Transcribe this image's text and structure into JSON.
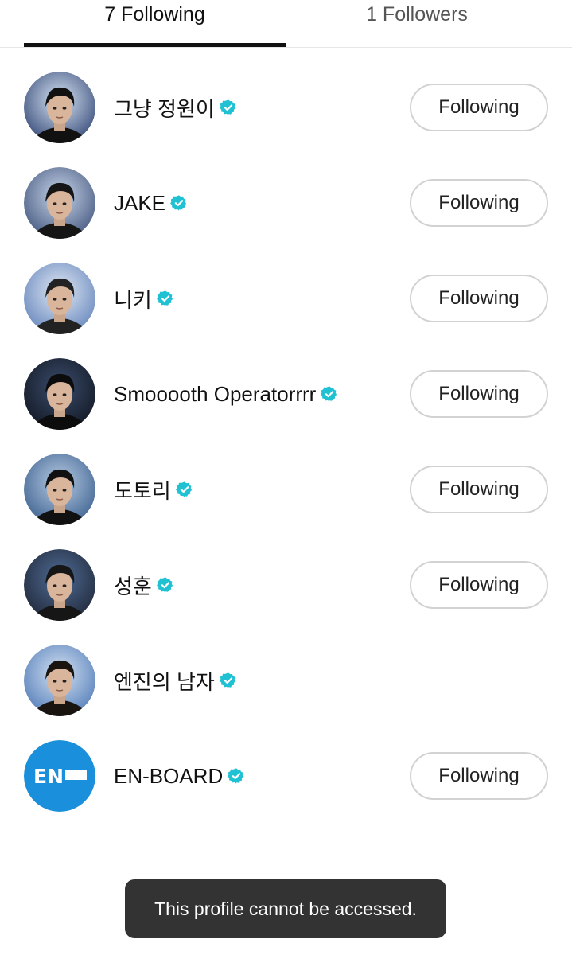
{
  "tabs": {
    "following": "7 Following",
    "followers": "1 Followers",
    "active": "following"
  },
  "accent_color": "#1fc1d3",
  "brand_color": "#1a8fdb",
  "follow_button_label": "Following",
  "users": [
    {
      "name": "그냥 정원이",
      "verified": true,
      "has_button": true,
      "avatar": "portrait"
    },
    {
      "name": "JAKE",
      "verified": true,
      "has_button": true,
      "avatar": "portrait"
    },
    {
      "name": "니키",
      "verified": true,
      "has_button": true,
      "avatar": "portrait"
    },
    {
      "name": "Smooooth Operatorrrr",
      "verified": true,
      "has_button": true,
      "avatar": "portrait"
    },
    {
      "name": "도토리",
      "verified": true,
      "has_button": true,
      "avatar": "portrait"
    },
    {
      "name": "성훈",
      "verified": true,
      "has_button": true,
      "avatar": "portrait"
    },
    {
      "name": "엔진의 남자",
      "verified": true,
      "has_button": false,
      "avatar": "portrait"
    },
    {
      "name": "EN-BOARD",
      "verified": true,
      "has_button": true,
      "avatar": "logo",
      "logo_text": "EN"
    }
  ],
  "toast": {
    "message": "This profile cannot be accessed."
  }
}
